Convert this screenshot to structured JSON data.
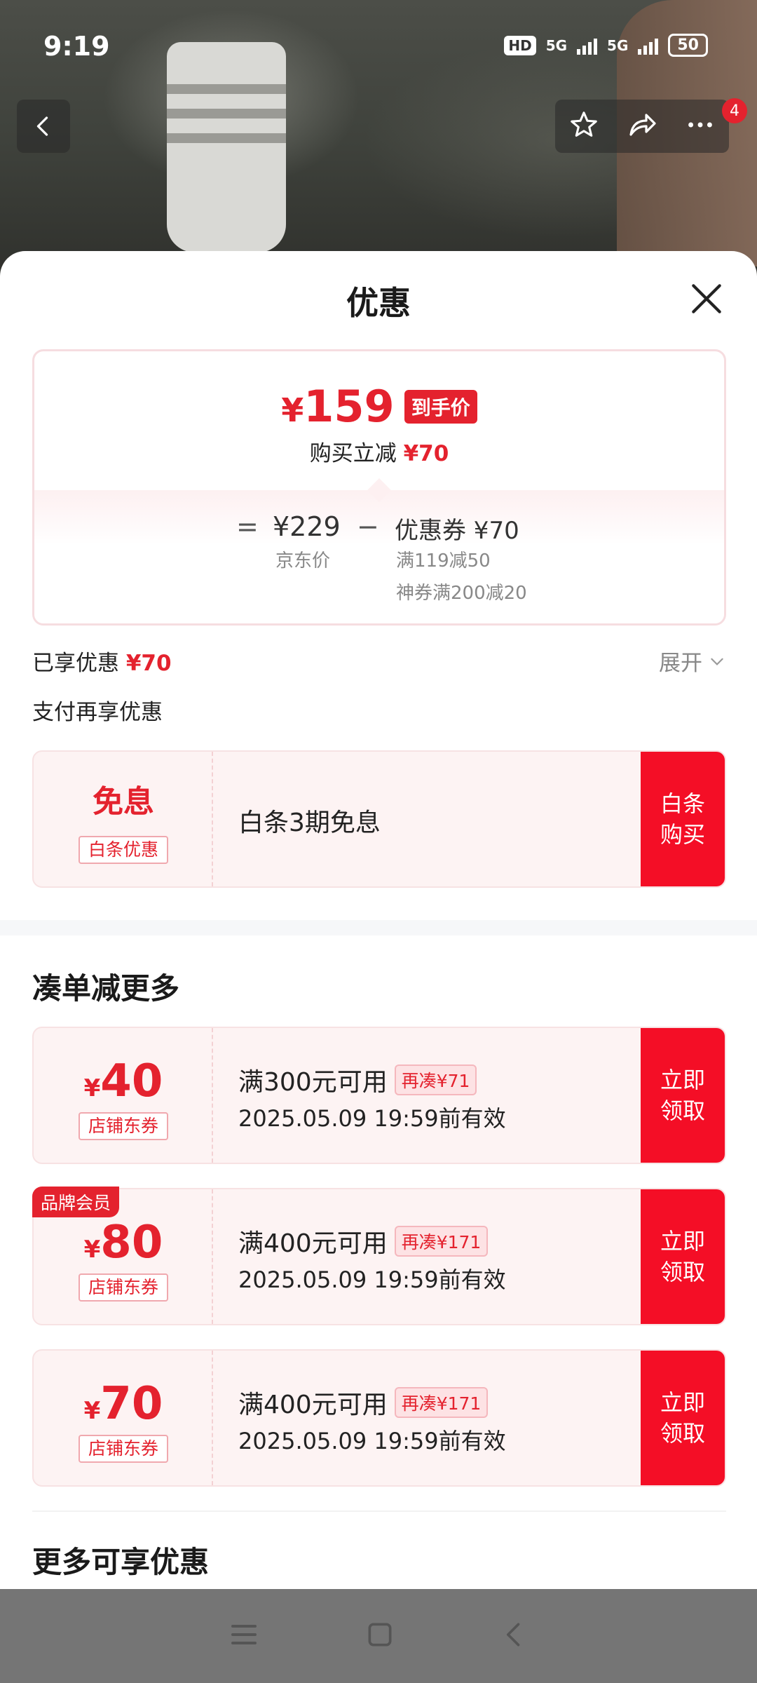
{
  "status_bar": {
    "time": "9:19",
    "hd": "HD",
    "net1": "5G",
    "net2": "5G",
    "battery": "50"
  },
  "top_actions": {
    "badge_count": "4"
  },
  "sheet": {
    "title": "优惠"
  },
  "price_card": {
    "yen": "¥",
    "final_price": "159",
    "final_tag": "到手价",
    "instant_label": "购买立减",
    "instant_amount": "¥70",
    "eq": "=",
    "jd_price": "¥229",
    "jd_label": "京东价",
    "minus": "−",
    "coupon_value": "优惠券 ¥70",
    "coupon_rule1": "满119减50",
    "coupon_rule2": "神券满200减20"
  },
  "enjoyed": {
    "label": "已享优惠",
    "amount": "¥70",
    "expand": "展开"
  },
  "pay_more": {
    "title": "支付再享优惠"
  },
  "baitiao": {
    "amount": "免息",
    "tag": "白条优惠",
    "desc": "白条3期免息",
    "button": "白条购买"
  },
  "section_more": {
    "title": "凑单减更多"
  },
  "coupons": [
    {
      "yen": "¥",
      "amount": "40",
      "tag": "店铺东券",
      "rule": "满300元可用",
      "extra": "再凑¥71",
      "valid": "2025.05.09 19:59前有效",
      "button": "立即领取"
    },
    {
      "yen": "¥",
      "amount": "80",
      "tag": "店铺东券",
      "rule": "满400元可用",
      "extra": "再凑¥171",
      "valid": "2025.05.09 19:59前有效",
      "button": "立即领取",
      "member": "品牌会员"
    },
    {
      "yen": "¥",
      "amount": "70",
      "tag": "店铺东券",
      "rule": "满400元可用",
      "extra": "再凑¥171",
      "valid": "2025.05.09 19:59前有效",
      "button": "立即领取"
    }
  ],
  "section_extra": {
    "title": "更多可享优惠"
  },
  "colors": {
    "accent_red": "#e4222e",
    "button_red": "#f40e26"
  },
  "icons": [
    "back-icon",
    "star-icon",
    "share-icon",
    "more-icon",
    "close-icon",
    "chevron-down-icon",
    "menu-icon",
    "home-icon",
    "nav-back-icon"
  ]
}
